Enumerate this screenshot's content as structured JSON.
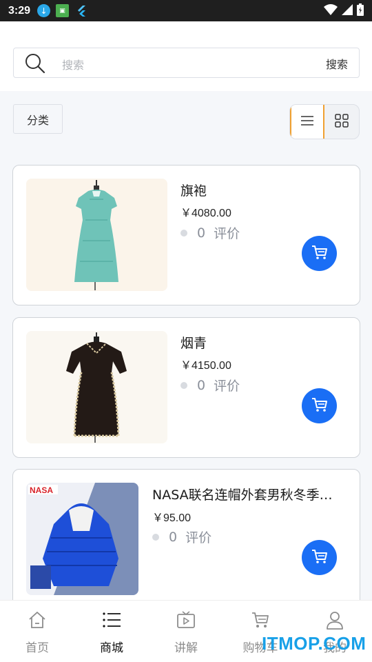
{
  "status_bar": {
    "time": "3:29",
    "left_icons": [
      "download-icon",
      "app-icon",
      "flutter-icon"
    ],
    "right_icons": [
      "wifi-icon",
      "signal-icon",
      "battery-icon"
    ]
  },
  "search": {
    "placeholder": "搜索",
    "button_label": "搜索"
  },
  "toolbar": {
    "category_label": "分类",
    "view_modes": [
      "list-view",
      "grid-view"
    ],
    "active_view": "list-view"
  },
  "products": [
    {
      "title": "旗袍",
      "price": "￥4080.00",
      "review_count": "0",
      "review_label": "评价"
    },
    {
      "title": "烟青",
      "price": "￥4150.00",
      "review_count": "0",
      "review_label": "评价"
    },
    {
      "title": "NASA联名连帽外套男秋冬季…",
      "price": "￥95.00",
      "review_count": "0",
      "review_label": "评价",
      "image_logo": "NASA"
    }
  ],
  "tabbar": {
    "tabs": [
      {
        "label": "首页",
        "icon": "home-icon"
      },
      {
        "label": "商城",
        "icon": "list-icon",
        "active": true
      },
      {
        "label": "讲解",
        "icon": "video-icon"
      },
      {
        "label": "购物车",
        "icon": "cart-icon"
      },
      {
        "label": "我的",
        "icon": "user-icon"
      }
    ]
  },
  "watermark": "ITMOP.COM",
  "colors": {
    "accent_blue": "#1a6ef5",
    "toggle_border": "#f0a030",
    "watermark": "#18a0e8"
  }
}
